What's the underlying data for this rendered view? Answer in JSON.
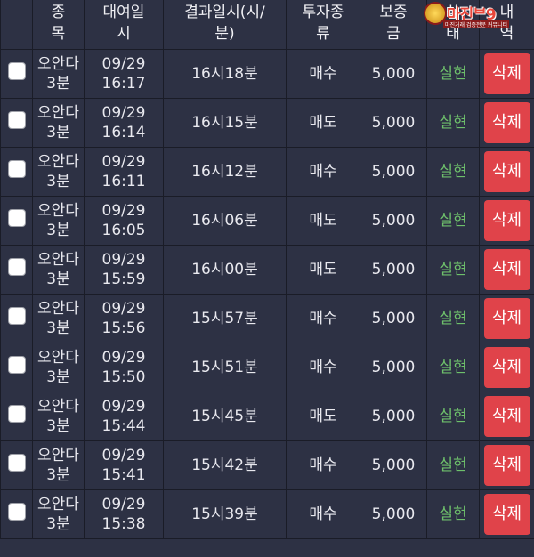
{
  "header": {
    "col_name": [
      "종",
      "목"
    ],
    "col_time": [
      "대여일",
      "시"
    ],
    "col_result": [
      "결과일시(시/",
      "분)"
    ],
    "col_type": [
      "투자종",
      "류"
    ],
    "col_deposit": [
      "보증",
      "금"
    ],
    "col_status": [
      "상",
      "태"
    ],
    "col_delete": [
      "내",
      "역"
    ]
  },
  "watermark": {
    "text": "마진",
    "suffix": "ᄇ9",
    "sub": "마진거래 검증전문 커뮤니티"
  },
  "rows": [
    {
      "name": [
        "오안다",
        "3분"
      ],
      "time": [
        "09/29",
        "16:17"
      ],
      "result": "16시18분",
      "type": "매수",
      "deposit": "5,000",
      "status": "실현",
      "delete": "삭제"
    },
    {
      "name": [
        "오안다",
        "3분"
      ],
      "time": [
        "09/29",
        "16:14"
      ],
      "result": "16시15분",
      "type": "매도",
      "deposit": "5,000",
      "status": "실현",
      "delete": "삭제"
    },
    {
      "name": [
        "오안다",
        "3분"
      ],
      "time": [
        "09/29",
        "16:11"
      ],
      "result": "16시12분",
      "type": "매수",
      "deposit": "5,000",
      "status": "실현",
      "delete": "삭제"
    },
    {
      "name": [
        "오안다",
        "3분"
      ],
      "time": [
        "09/29",
        "16:05"
      ],
      "result": "16시06분",
      "type": "매도",
      "deposit": "5,000",
      "status": "실현",
      "delete": "삭제"
    },
    {
      "name": [
        "오안다",
        "3분"
      ],
      "time": [
        "09/29",
        "15:59"
      ],
      "result": "16시00분",
      "type": "매도",
      "deposit": "5,000",
      "status": "실현",
      "delete": "삭제"
    },
    {
      "name": [
        "오안다",
        "3분"
      ],
      "time": [
        "09/29",
        "15:56"
      ],
      "result": "15시57분",
      "type": "매수",
      "deposit": "5,000",
      "status": "실현",
      "delete": "삭제"
    },
    {
      "name": [
        "오안다",
        "3분"
      ],
      "time": [
        "09/29",
        "15:50"
      ],
      "result": "15시51분",
      "type": "매수",
      "deposit": "5,000",
      "status": "실현",
      "delete": "삭제"
    },
    {
      "name": [
        "오안다",
        "3분"
      ],
      "time": [
        "09/29",
        "15:44"
      ],
      "result": "15시45분",
      "type": "매도",
      "deposit": "5,000",
      "status": "실현",
      "delete": "삭제"
    },
    {
      "name": [
        "오안다",
        "3분"
      ],
      "time": [
        "09/29",
        "15:41"
      ],
      "result": "15시42분",
      "type": "매수",
      "deposit": "5,000",
      "status": "실현",
      "delete": "삭제"
    },
    {
      "name": [
        "오안다",
        "3분"
      ],
      "time": [
        "09/29",
        "15:38"
      ],
      "result": "15시39분",
      "type": "매수",
      "deposit": "5,000",
      "status": "실현",
      "delete": "삭제"
    }
  ],
  "colors": {
    "background": "#2d3144",
    "status_green": "#6ec06b",
    "delete_red": "#e0434a"
  }
}
